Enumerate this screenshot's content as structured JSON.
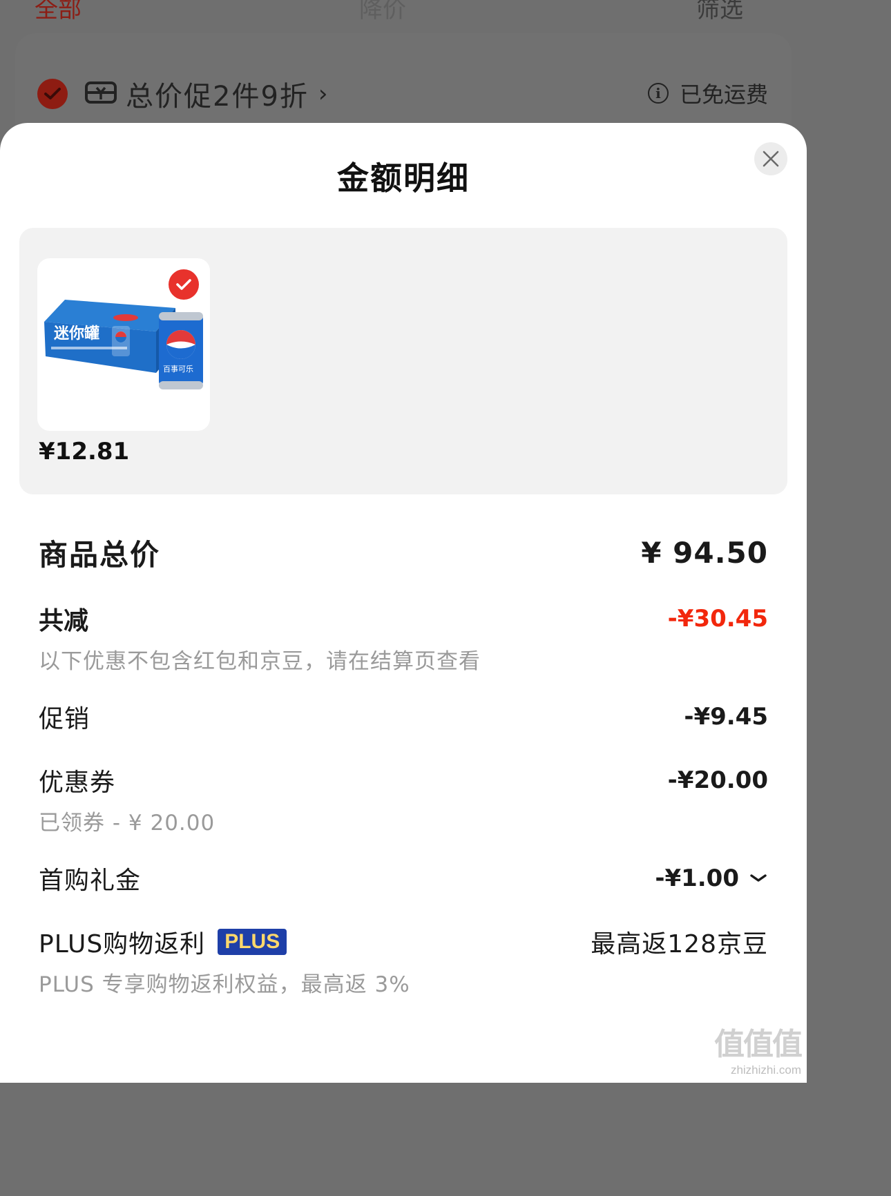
{
  "background": {
    "tabs": [
      "全部",
      "降价",
      "筛选"
    ],
    "promo_text": "总价促2件9折",
    "promo_chevron": "›",
    "shipping_text": "已免运费"
  },
  "sheet": {
    "title": "金额明细",
    "product": {
      "price": "¥12.81",
      "image_desc": "pepsi-mini-cans-box",
      "box_text": "迷你罐",
      "can_text": "百事可乐"
    },
    "rows": {
      "total": {
        "label": "商品总价",
        "amount": "¥ 94.50"
      },
      "discount": {
        "label": "共减",
        "amount": "-¥30.45",
        "note": "以下优惠不包含红包和京豆，请在结算页查看"
      },
      "promotion": {
        "label": "促销",
        "amount": "-¥9.45"
      },
      "coupon": {
        "label": "优惠券",
        "amount": "-¥20.00",
        "note": "已领券 - ¥ 20.00"
      },
      "first_purchase": {
        "label": "首购礼金",
        "amount": "-¥1.00"
      },
      "plus": {
        "label": "PLUS购物返利",
        "badge": "PLUS",
        "amount": "最高返128京豆",
        "note": "PLUS 专享购物返利权益，最高返 3%"
      }
    }
  },
  "watermark": {
    "glyphs": "值值值",
    "url": "zhizhizhi.com"
  },
  "colors": {
    "accent_red": "#f2270c",
    "check_red": "#e8322c",
    "plus_badge_bg": "#1e3fa8",
    "plus_badge_text": "#ffd86b"
  }
}
